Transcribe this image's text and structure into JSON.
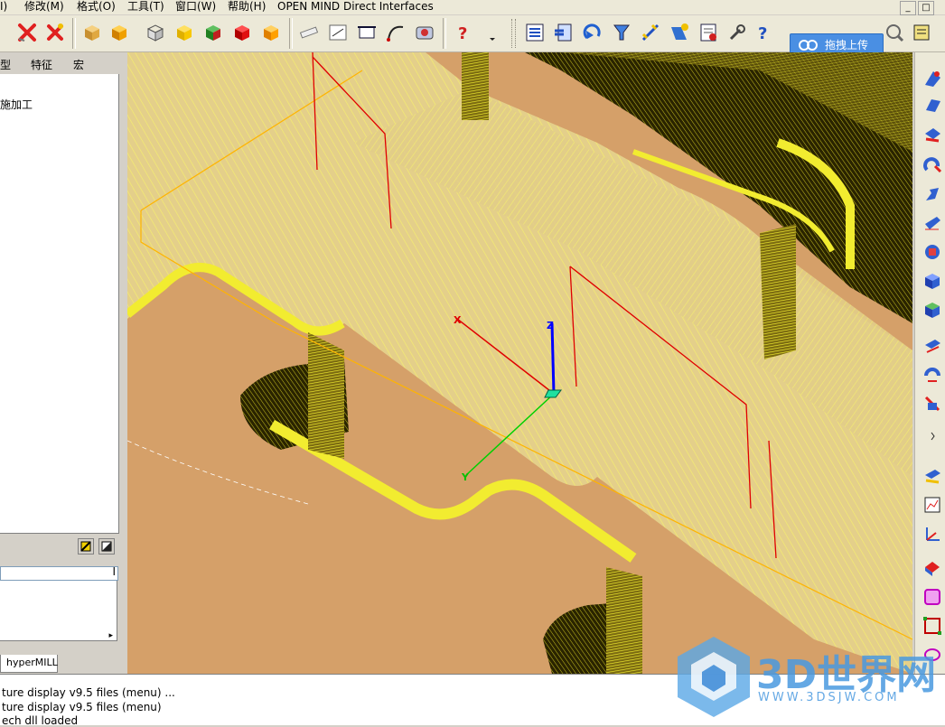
{
  "menubar": {
    "items": [
      "I)",
      "修改(M)",
      "格式(O)",
      "工具(T)",
      "窗口(W)",
      "帮助(H)",
      "OPEN MIND Direct Interfaces"
    ],
    "minimize": "_",
    "restore": "□"
  },
  "cloud_upload": {
    "label": "拖拽上传"
  },
  "left_panel": {
    "tabs": [
      "型",
      "特征",
      "宏"
    ],
    "tree_item": "施加工",
    "bottom_tab": "hyperMILL"
  },
  "status": {
    "lines": [
      "ture display v9.5 files (menu) ...",
      "ture display v9.5 files (menu)",
      "ech dll loaded"
    ]
  },
  "axes": {
    "x": "X",
    "y": "Y",
    "z": "Z"
  },
  "watermark": {
    "text": "3D世界网",
    "url": "WWW.3DSJW.COM"
  },
  "colors": {
    "viewport_bg": "#d5a069",
    "toolpath": "#f5f06e",
    "toolpath_dense": "#e6e000",
    "boundary": "#ffb400",
    "axis_x": "#e00000",
    "axis_y": "#00d000",
    "axis_z": "#0000ff"
  }
}
